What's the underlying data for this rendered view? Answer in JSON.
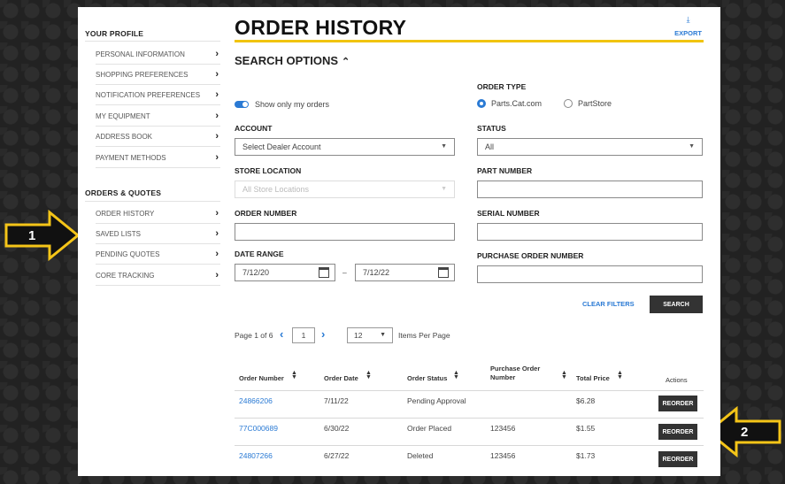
{
  "sidebar": {
    "profile_title": "YOUR PROFILE",
    "profile_items": [
      {
        "label": "PERSONAL INFORMATION"
      },
      {
        "label": "SHOPPING PREFERENCES"
      },
      {
        "label": "NOTIFICATION PREFERENCES"
      },
      {
        "label": "MY EQUIPMENT"
      },
      {
        "label": "ADDRESS BOOK"
      },
      {
        "label": "PAYMENT METHODS"
      }
    ],
    "orders_title": "ORDERS & QUOTES",
    "orders_items": [
      {
        "label": "ORDER HISTORY"
      },
      {
        "label": "SAVED LISTS"
      },
      {
        "label": "PENDING QUOTES"
      },
      {
        "label": "CORE TRACKING"
      }
    ],
    "chevron": "›"
  },
  "header": {
    "title": "ORDER HISTORY",
    "export_label": "EXPORT",
    "export_icon": "⤓"
  },
  "search": {
    "title": "SEARCH OPTIONS",
    "caret": "⌃",
    "toggle_label": "Show only my orders",
    "toggle_on": true,
    "order_type_label": "ORDER TYPE",
    "order_type_options": [
      "Parts.Cat.com",
      "PartStore"
    ],
    "order_type_selected": "Parts.Cat.com",
    "account_label": "ACCOUNT",
    "account_value": "Select Dealer Account",
    "status_label": "STATUS",
    "status_value": "All",
    "store_location_label": "STORE LOCATION",
    "store_location_value": "All Store Locations",
    "part_number_label": "PART NUMBER",
    "part_number_value": "",
    "order_number_label": "ORDER NUMBER",
    "order_number_value": "",
    "serial_number_label": "SERIAL NUMBER",
    "serial_number_value": "",
    "date_range_label": "DATE RANGE",
    "date_from": "7/12/20",
    "date_to": "7/12/22",
    "date_separator": "–",
    "po_number_label": "PURCHASE ORDER NUMBER",
    "po_number_value": "",
    "clear_filters_label": "CLEAR FILTERS",
    "search_button_label": "SEARCH"
  },
  "pager": {
    "page_text": "Page 1 of 6",
    "current_page": "1",
    "per_page_value": "12",
    "per_page_label": "Items Per Page",
    "prev": "‹",
    "next": "›"
  },
  "table": {
    "headers": {
      "order_number": "Order Number",
      "order_date": "Order Date",
      "order_status": "Order Status",
      "po_number_line1": "Purchase Order",
      "po_number_line2": "Number",
      "total_price": "Total Price",
      "actions": "Actions"
    },
    "sort_icon": "⌃⌄",
    "rows": [
      {
        "order_number": "24866206",
        "order_date": "7/11/22",
        "status": "Pending Approval",
        "po": "",
        "total": "$6.28",
        "action": "REORDER"
      },
      {
        "order_number": "77C000689",
        "order_date": "6/30/22",
        "status": "Order Placed",
        "po": "123456",
        "total": "$1.55",
        "action": "REORDER"
      },
      {
        "order_number": "24807266",
        "order_date": "6/27/22",
        "status": "Deleted",
        "po": "123456",
        "total": "$1.73",
        "action": "REORDER"
      }
    ]
  },
  "callouts": {
    "one": "1",
    "two": "2",
    "color": "#f5c518"
  }
}
